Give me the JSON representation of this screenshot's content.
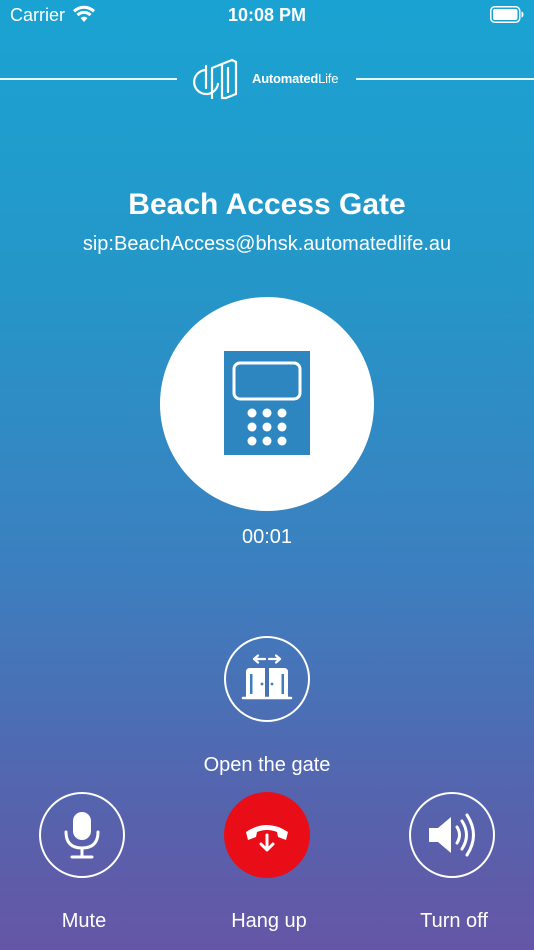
{
  "status_bar": {
    "carrier": "Carrier",
    "time": "10:08 PM",
    "wifi_icon": "wifi-icon",
    "battery_icon": "battery-full-icon"
  },
  "brand": {
    "name_bold": "Automated",
    "name_light": "Life",
    "logo_icon": "automatedlife-logo-icon"
  },
  "caller": {
    "name": "Beach Access Gate",
    "sip": "sip:BeachAccess@bhsk.automatedlife.au",
    "avatar_icon": "intercom-keypad-icon",
    "avatar_color": "#2d86c0"
  },
  "call": {
    "duration": "00:01"
  },
  "actions": {
    "open_gate_label": "Open the gate",
    "open_gate_icon": "gate-open-icon",
    "mute_label": "Mute",
    "mute_icon": "microphone-icon",
    "hangup_label": "Hang up",
    "hangup_icon": "hang-up-icon",
    "hangup_color": "#e80d17",
    "speaker_label": "Turn off",
    "speaker_icon": "speaker-volume-icon"
  }
}
